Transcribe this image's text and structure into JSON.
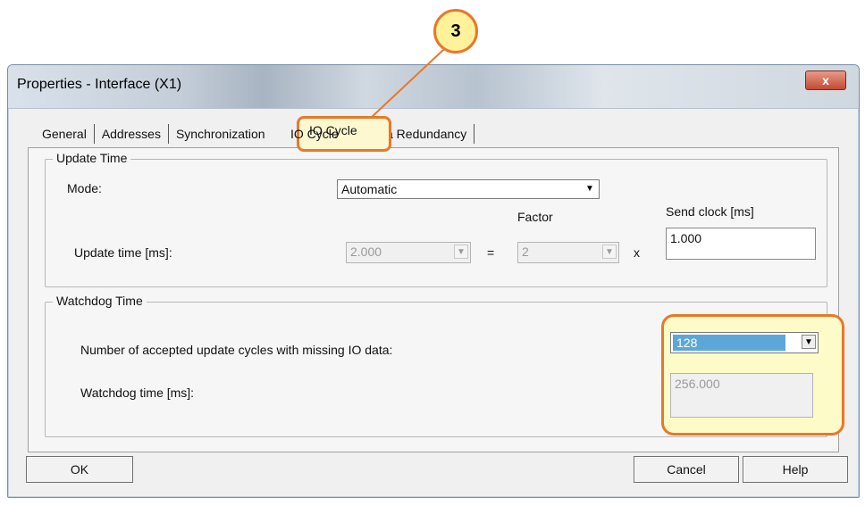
{
  "window": {
    "title": "Properties - Interface (X1)",
    "close_label": "x"
  },
  "tabs": [
    {
      "label": "General"
    },
    {
      "label": "Addresses"
    },
    {
      "label": "Synchronization"
    },
    {
      "label": "IO Cycle"
    },
    {
      "label": "Media Redundancy"
    }
  ],
  "active_tab": "IO Cycle",
  "callout": {
    "number": "3"
  },
  "update_time": {
    "group_title": "Update Time",
    "mode_label": "Mode:",
    "mode_value": "Automatic",
    "factor_header": "Factor",
    "send_clock_header": "Send clock [ms]",
    "update_label": "Update time [ms]:",
    "update_value": "2.000",
    "equals": "=",
    "factor_value": "2",
    "times": "x",
    "send_clock_value": "1.000"
  },
  "watchdog": {
    "group_title": "Watchdog Time",
    "cycles_label": "Number of accepted update cycles with missing IO data:",
    "cycles_value": "128",
    "time_label": "Watchdog time [ms]:",
    "time_value": "256.000"
  },
  "buttons": {
    "ok": "OK",
    "cancel": "Cancel",
    "help": "Help"
  },
  "colors": {
    "highlight_border": "#e8782a",
    "highlight_fill": "#fdfbc7",
    "selection": "#5ba8d8"
  }
}
